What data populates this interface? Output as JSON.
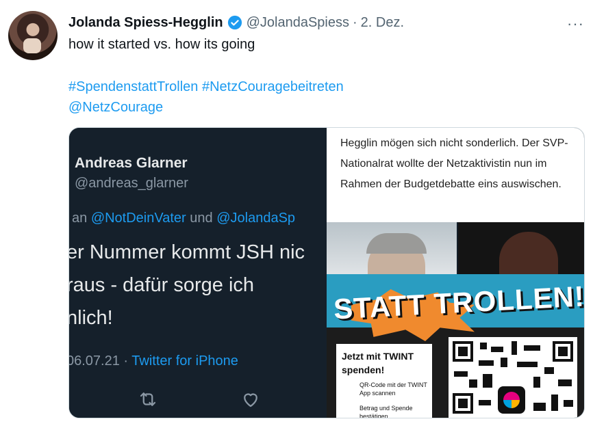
{
  "tweet": {
    "author_name": "Jolanda Spiess-Hegglin",
    "author_handle": "@JolandaSpiess",
    "separator": "·",
    "date": "2. Dez.",
    "more_label": "···",
    "text": "how it started vs. how its going",
    "hashtags": [
      "#SpendenstattTrollen",
      "#NetzCouragebeitreten"
    ],
    "mention": "@NetzCourage"
  },
  "media": {
    "left": {
      "quoted_name": "Andreas Glarner",
      "quoted_handle": "@andreas_glarner",
      "reply_prefix": "an",
      "reply_mention_1": "@NotDeinVater",
      "reply_and": "und",
      "reply_mention_2": "@JolandaSp",
      "body_lines": [
        "er Nummer kommt JSH nic",
        "raus - dafür sorge ich",
        "nlich!"
      ],
      "date": "06.07.21",
      "meta_sep": "·",
      "source": "Twitter for iPhone"
    },
    "article_text": "Hegglin mögen sich nicht sonderlich. Der SVP-Nationalrat wollte der Netzaktivistin nun im Rahmen der Budgetdebatte eins auswischen.",
    "poster": {
      "headline": "STATT TROLLEN!",
      "cta": "Jetzt mit TWINT spenden!",
      "step_1": "QR-Code mit der TWINT App scannen",
      "step_2": "Betrag und Spende bestätigen"
    }
  },
  "icons": {
    "verified": "verified-badge-icon",
    "retweet": "retweet-icon",
    "like": "heart-icon"
  },
  "colors": {
    "link": "#1d9bf0",
    "dark_bg": "#15202b",
    "muted": "#536471"
  }
}
